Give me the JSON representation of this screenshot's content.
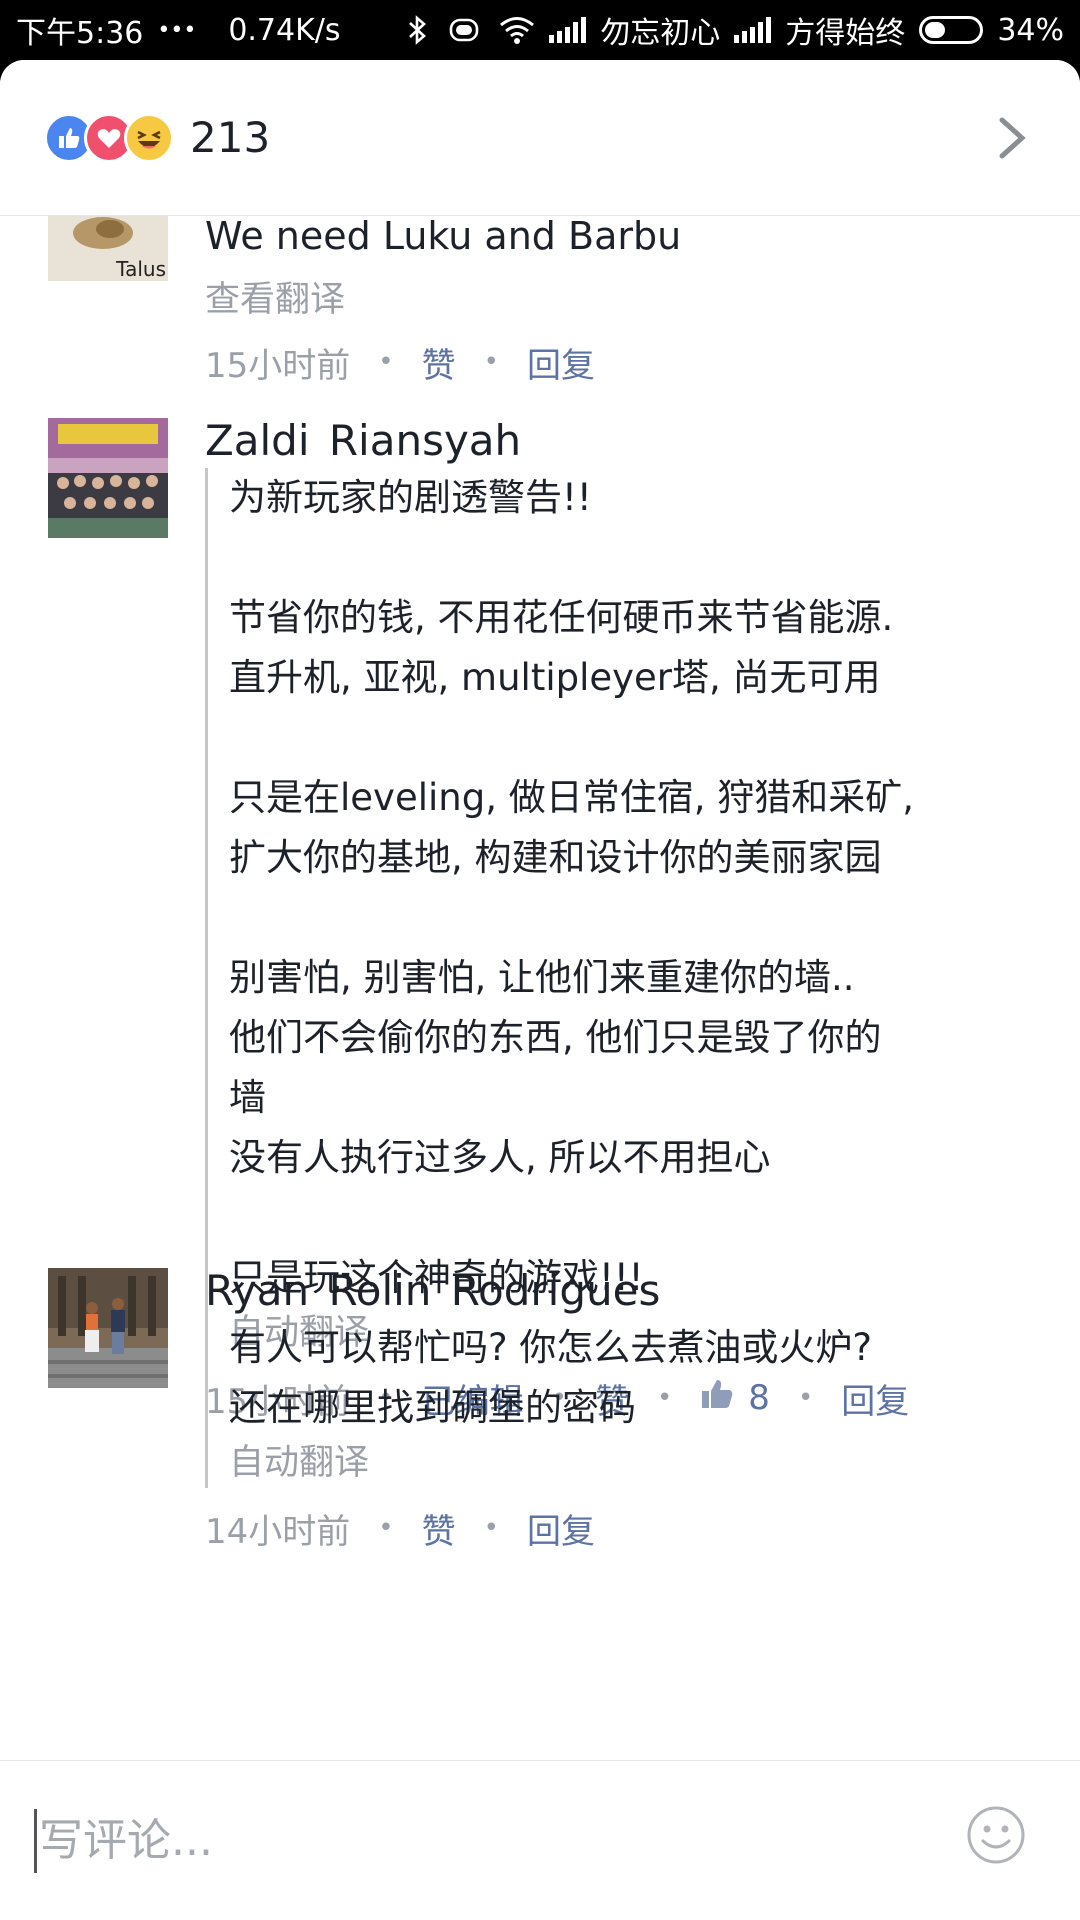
{
  "status_bar": {
    "time": "下午5:36",
    "dots": "•••",
    "speed": "0.74K/s",
    "carrier1": "勿忘初心",
    "carrier2": "方得始终",
    "battery": "34%"
  },
  "reactions": {
    "icons": [
      "like-icon",
      "love-icon",
      "haha-icon"
    ],
    "count": "213"
  },
  "comments": [
    {
      "author": "",
      "avatar_caption": "Talus",
      "text": "We need Luku and Barbu",
      "translate_label": "查看翻译",
      "time": "15小时前",
      "like_label": "赞",
      "reply_label": "回复"
    },
    {
      "author": "Zaldi Riansyah",
      "text": "为新玩家的剧透警告!!\n\n节省你的钱, 不用花任何硬币来节省能源.\n直升机, 亚视, multipleyer塔, 尚无可用\n\n只是在leveling, 做日常住宿, 狩猎和采矿,\n扩大你的基地, 构建和设计你的美丽家园\n\n别害怕, 别害怕, 让他们来重建你的墙..\n他们不会偷你的东西, 他们只是毁了你的\n墙\n没有人执行过多人, 所以不用担心\n\n只是玩这个神奇的游戏!!!",
      "translate_label": "自动翻译",
      "time": "15小时前",
      "edited_label": "已编辑",
      "like_label": "赞",
      "like_count": "8",
      "reply_label": "回复"
    },
    {
      "author": "Ryan Rolin Rodrigues",
      "text": "有人可以帮忙吗? 你怎么去煮油或火炉?\n还在哪里找到碉堡的密码",
      "translate_label": "自动翻译",
      "time": "14小时前",
      "like_label": "赞",
      "reply_label": "回复"
    }
  ],
  "composer": {
    "placeholder": "写评论..."
  },
  "colors": {
    "link": "#5d73a3",
    "muted": "#9ba0a8",
    "text": "#1d2129"
  }
}
